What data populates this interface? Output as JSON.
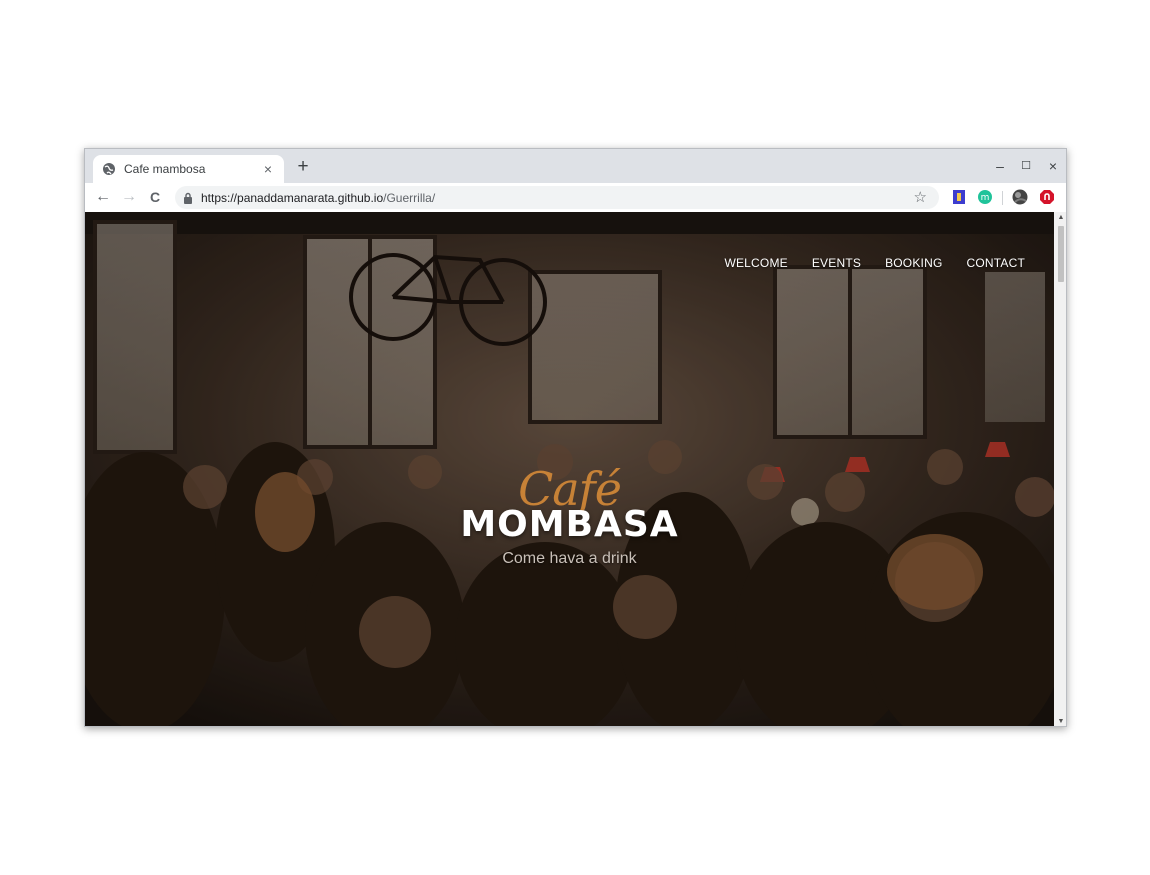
{
  "browser": {
    "tab": {
      "title": "Cafe mambosa",
      "close_glyph": "×"
    },
    "new_tab_glyph": "+",
    "window_controls": {
      "minimize": "–",
      "maximize": "☐",
      "close": "×"
    },
    "nav": {
      "back": "←",
      "forward": "→",
      "reload": "C"
    },
    "address": {
      "host": "https://panaddamanarata.github.io",
      "path": "/Guerrilla/"
    },
    "bookmark_glyph": "☆",
    "extensions": [
      {
        "icon": "bookmark-extension-icon",
        "color": "#3d3dce"
      },
      {
        "icon": "mercury-extension-icon",
        "color": "#20c39a",
        "glyph": "m"
      },
      {
        "icon": "profile-avatar-icon",
        "color": "#444444"
      },
      {
        "icon": "adblock-extension-icon",
        "color": "#d4142a"
      }
    ]
  },
  "site": {
    "nav": [
      "WELCOME",
      "EVENTS",
      "BOOKING",
      "CONTACT"
    ],
    "hero": {
      "script": "Café",
      "title": "MOMBASA",
      "subtitle": "Come hava a drink"
    },
    "colors": {
      "accent": "#d58a38",
      "text": "#ffffff"
    }
  }
}
